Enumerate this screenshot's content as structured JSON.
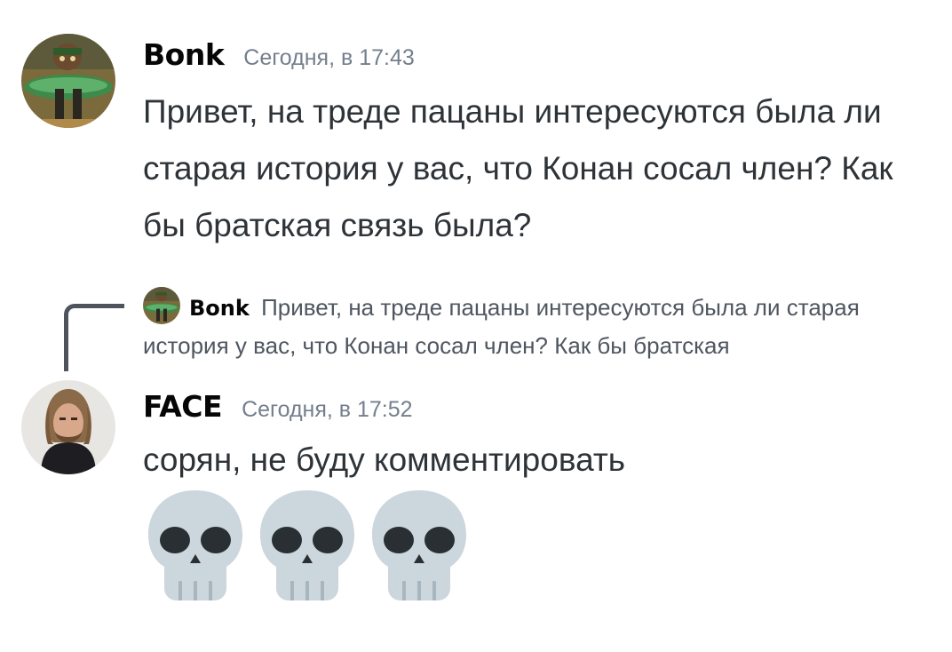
{
  "messages": [
    {
      "author": "Bonk",
      "timestamp": "Сегодня, в 17:43",
      "text": "Привет, на треде пацаны интересуются была ли старая история у вас, что Конан сосал член? Как бы братская связь была?"
    },
    {
      "author": "FACE",
      "timestamp": "Сегодня, в 17:52",
      "text": "сорян, не буду комментировать",
      "emoji": [
        "skull-emoji",
        "skull-emoji",
        "skull-emoji"
      ]
    }
  ],
  "reply": {
    "author": "Bonk",
    "preview": "Привет, на треде пацаны интересуются была ли старая история у вас, что Конан сосал член? Как бы братская"
  },
  "colors": {
    "background": "#ffffff",
    "username": "#060607",
    "timestamp": "#747f8d",
    "message_text": "#2e3338",
    "reply_spine": "#4f545c",
    "skull": "#ccd6dd",
    "skull_features": "#292f33"
  }
}
